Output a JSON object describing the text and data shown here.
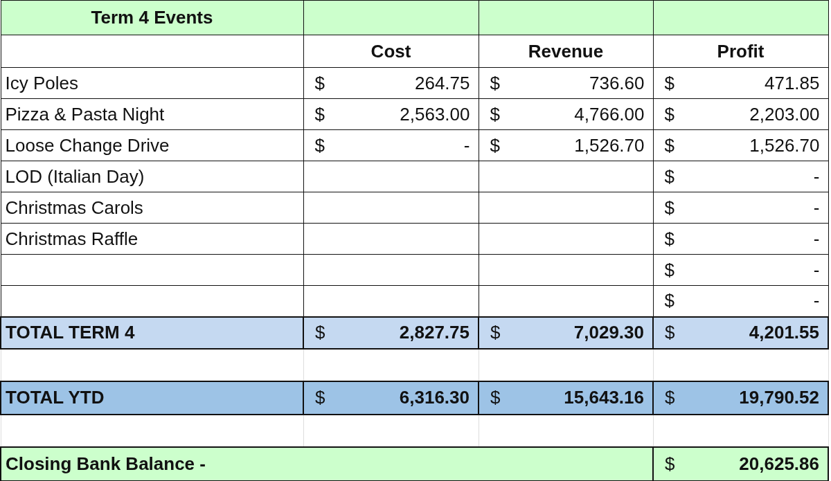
{
  "title": "Term 4 Events",
  "columns": [
    "Cost",
    "Revenue",
    "Profit"
  ],
  "events": [
    {
      "name": "Icy Poles",
      "cost": {
        "symbol": "$",
        "amount": "264.75"
      },
      "revenue": {
        "symbol": "$",
        "amount": "736.60"
      },
      "profit": {
        "symbol": "$",
        "amount": "471.85"
      }
    },
    {
      "name": "Pizza & Pasta Night",
      "cost": {
        "symbol": "$",
        "amount": "2,563.00"
      },
      "revenue": {
        "symbol": "$",
        "amount": "4,766.00"
      },
      "profit": {
        "symbol": "$",
        "amount": "2,203.00"
      }
    },
    {
      "name": "Loose Change Drive",
      "cost": {
        "symbol": "$",
        "amount": "-"
      },
      "revenue": {
        "symbol": "$",
        "amount": "1,526.70"
      },
      "profit": {
        "symbol": "$",
        "amount": "1,526.70"
      }
    },
    {
      "name": "LOD (Italian Day)",
      "profit": {
        "symbol": "$",
        "amount": "-"
      }
    },
    {
      "name": "Christmas Carols",
      "profit": {
        "symbol": "$",
        "amount": "-"
      }
    },
    {
      "name": "Christmas Raffle",
      "profit": {
        "symbol": "$",
        "amount": "-"
      }
    },
    {
      "profit": {
        "symbol": "$",
        "amount": "-"
      }
    },
    {
      "profit": {
        "symbol": "$",
        "amount": "-"
      }
    }
  ],
  "totals": [
    {
      "kind": "term",
      "label": "TOTAL TERM 4",
      "cost": {
        "symbol": "$",
        "amount": "2,827.75"
      },
      "revenue": {
        "symbol": "$",
        "amount": "7,029.30"
      },
      "profit": {
        "symbol": "$",
        "amount": "4,201.55"
      }
    },
    {
      "kind": "ytd",
      "label": "TOTAL YTD",
      "cost": {
        "symbol": "$",
        "amount": "6,316.30"
      },
      "revenue": {
        "symbol": "$",
        "amount": "15,643.16"
      },
      "profit": {
        "symbol": "$",
        "amount": "19,790.52"
      }
    }
  ],
  "closing": {
    "label": "Closing Bank Balance -",
    "balance": {
      "symbol": "$",
      "amount": "20,625.86"
    }
  }
}
